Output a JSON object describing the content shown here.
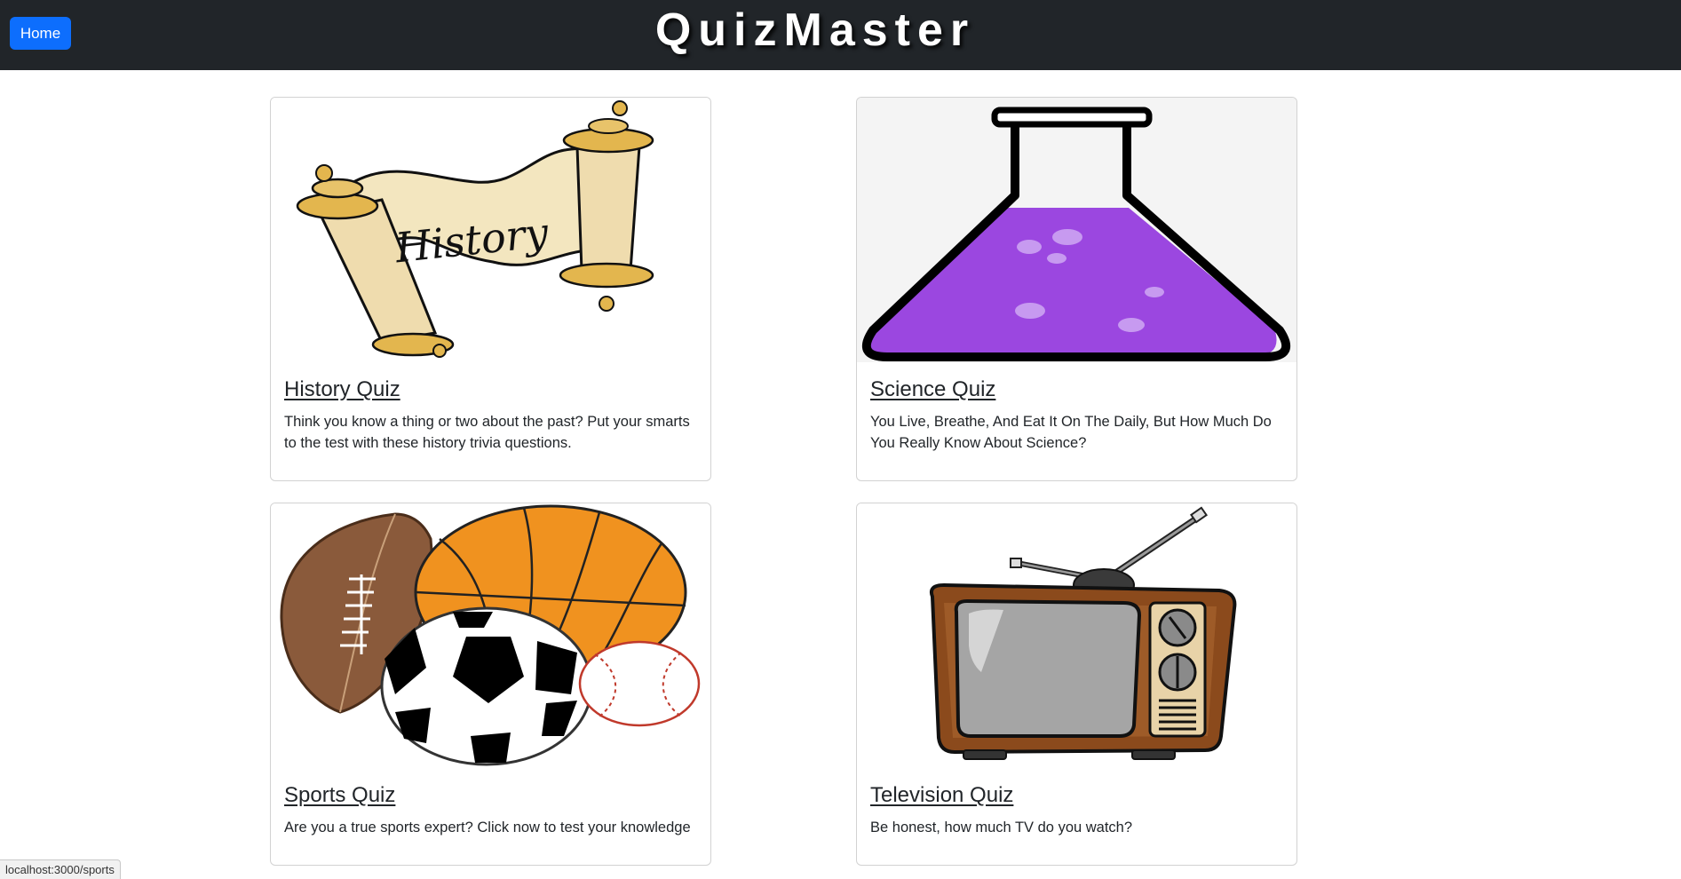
{
  "navbar": {
    "home_label": "Home",
    "brand": "QuizMaster",
    "background": "#212529",
    "button_color": "#0d6efd"
  },
  "cards": [
    {
      "title": "History Quiz",
      "text": "Think you know a thing or two about the past? Put your smarts to the test with these history trivia questions.",
      "image": "history-scroll-illustration"
    },
    {
      "title": "Science Quiz",
      "text": "You Live, Breathe, And Eat It On The Daily, But How Much Do You Really Know About Science?",
      "image": "science-flask-illustration"
    },
    {
      "title": "Sports Quiz",
      "text": "Are you a true sports expert? Click now to test your knowledge",
      "image": "sports-balls-illustration"
    },
    {
      "title": "Television Quiz",
      "text": "Be honest, how much TV do you watch?",
      "image": "television-set-illustration"
    }
  ],
  "status_bar": {
    "url": "localhost:3000/sports"
  },
  "colors": {
    "flask_liquid": "#9b47e0",
    "basketball": "#f0921f",
    "football": "#8a5a3b",
    "tv_body": "#8b4a1c"
  }
}
